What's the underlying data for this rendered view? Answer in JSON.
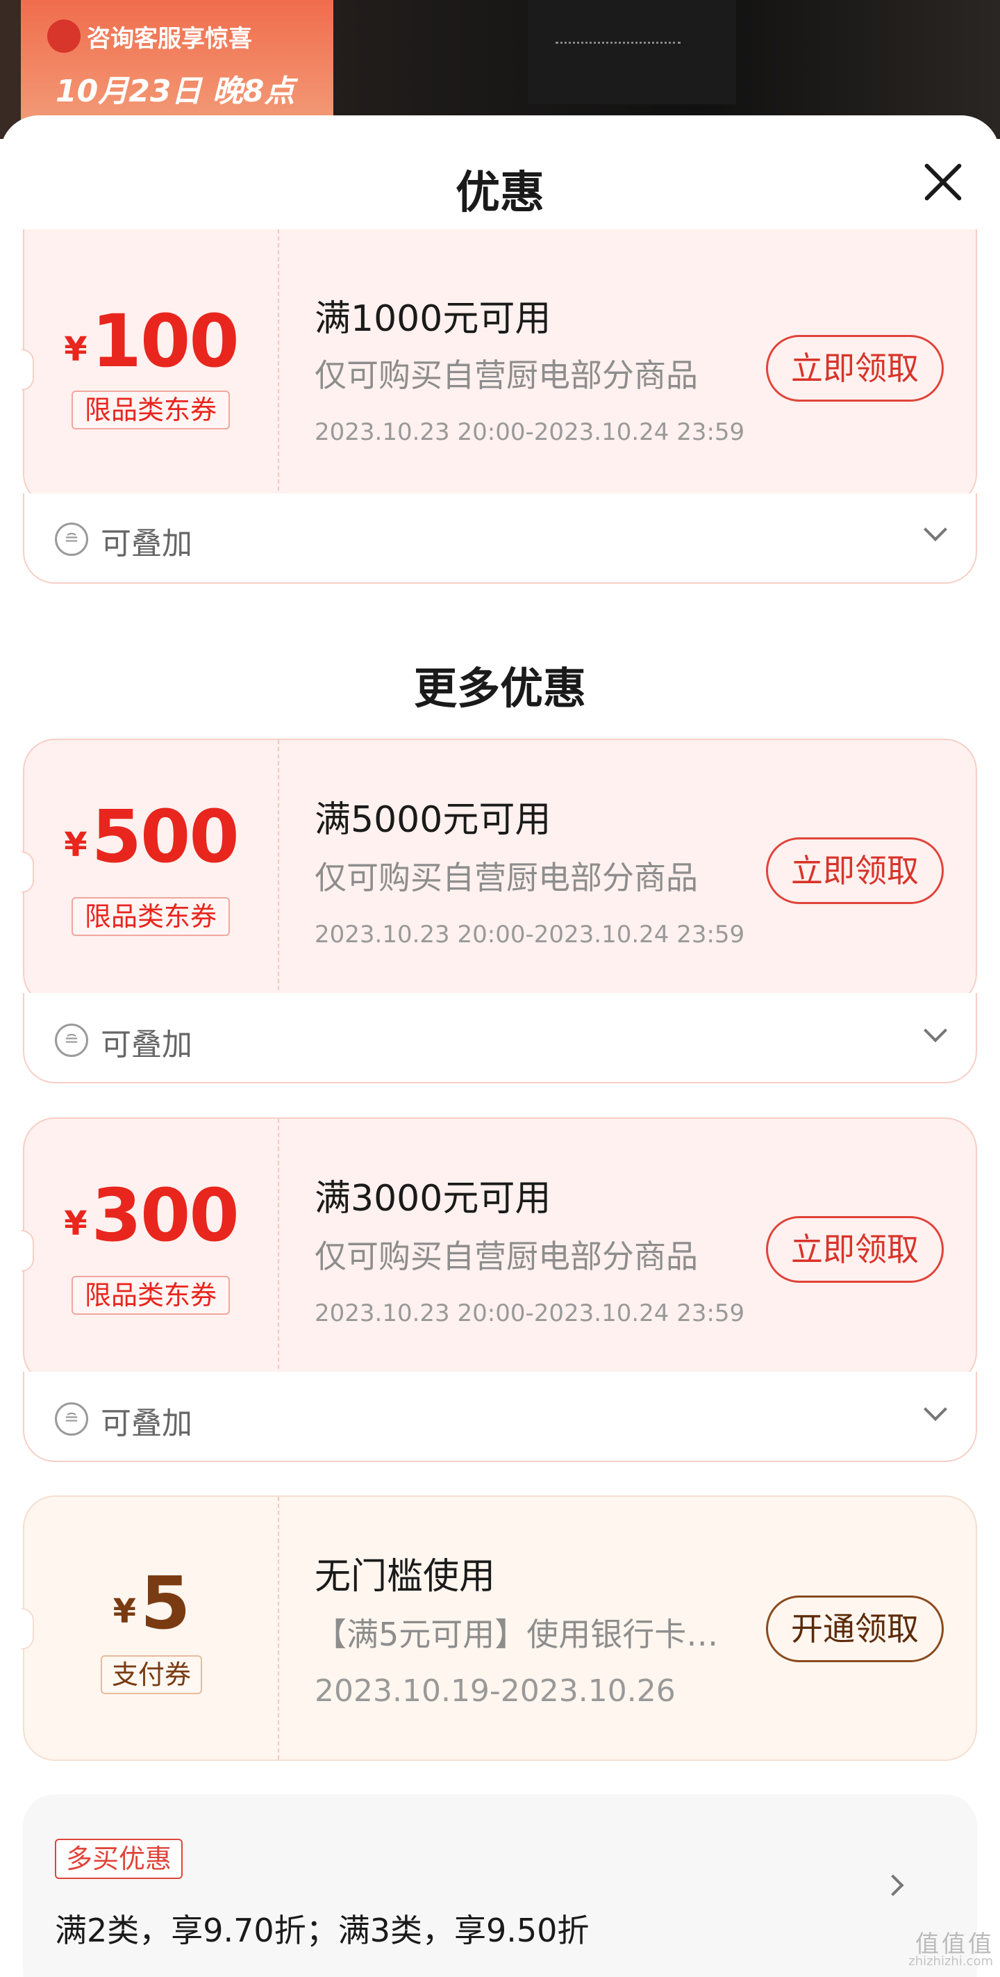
{
  "background": {
    "promo_line1": "咨询客服享惊喜",
    "promo_line2": "10月23日 晚8点"
  },
  "sheet": {
    "title": "优惠",
    "close_icon": "close-icon"
  },
  "first_coupon": {
    "currency": "¥",
    "amount": "100",
    "tag": "限品类东券",
    "condition": "满1000元可用",
    "description": "仅可购买自营厨电部分商品",
    "validity": "2023.10.23 20:00-2023.10.24 23:59",
    "button": "立即领取",
    "stack_label": "可叠加"
  },
  "more": {
    "title": "更多优惠",
    "coupons": [
      {
        "currency": "¥",
        "amount": "500",
        "tag": "限品类东券",
        "condition": "满5000元可用",
        "description": "仅可购买自营厨电部分商品",
        "validity": "2023.10.23 20:00-2023.10.24 23:59",
        "button": "立即领取",
        "stack_label": "可叠加"
      },
      {
        "currency": "¥",
        "amount": "300",
        "tag": "限品类东券",
        "condition": "满3000元可用",
        "description": "仅可购买自营厨电部分商品",
        "validity": "2023.10.23 20:00-2023.10.24 23:59",
        "button": "立即领取",
        "stack_label": "可叠加"
      },
      {
        "currency": "¥",
        "amount": "5",
        "tag": "支付券",
        "condition": "无门槛使用",
        "description": "【满5元可用】使用银行卡…",
        "validity": "2023.10.19-2023.10.26",
        "button": "开通领取"
      }
    ]
  },
  "multi_buy": {
    "tag": "多买优惠",
    "text": "满2类，享9.70折；满3类，享9.50折"
  },
  "watermark": {
    "main": "值值值",
    "sub": "zhizhizhi.com"
  },
  "colors": {
    "accent_red": "#e8261e",
    "pay_brown": "#7a3b12",
    "coupon_bg": "#fff1ef"
  }
}
